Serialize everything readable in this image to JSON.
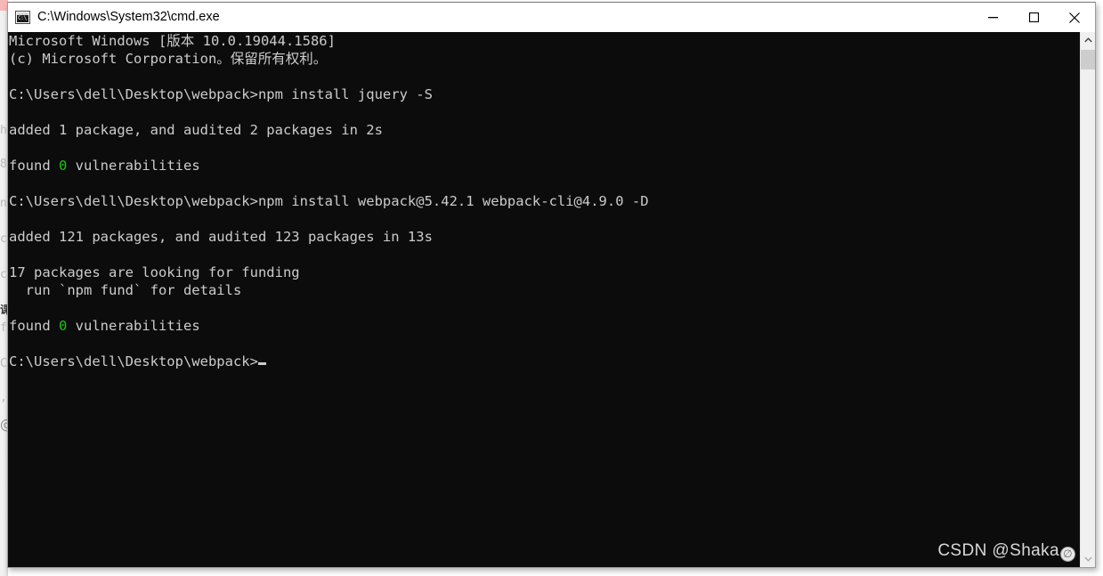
{
  "window": {
    "title": "C:\\Windows\\System32\\cmd.exe",
    "icon": "cmd-console-icon",
    "controls": {
      "minimize": "minimize-button",
      "maximize": "maximize-button",
      "close": "close-button"
    }
  },
  "console": {
    "background_color": "#0c0c0c",
    "foreground_color": "#cccccc",
    "highlight_color": "#16c60c",
    "lines": [
      {
        "text": "Microsoft Windows [版本 10.0.19044.1586]"
      },
      {
        "text": "(c) Microsoft Corporation。保留所有权利。"
      },
      {
        "text": ""
      },
      {
        "text": "C:\\Users\\dell\\Desktop\\webpack>npm install jquery -S"
      },
      {
        "text": ""
      },
      {
        "text": "added 1 package, and audited 2 packages in 2s"
      },
      {
        "text": ""
      },
      {
        "pre": "found ",
        "accent": "0",
        "post": " vulnerabilities"
      },
      {
        "text": ""
      },
      {
        "text": "C:\\Users\\dell\\Desktop\\webpack>npm install webpack@5.42.1 webpack-cli@4.9.0 -D"
      },
      {
        "text": ""
      },
      {
        "text": "added 121 packages, and audited 123 packages in 13s"
      },
      {
        "text": ""
      },
      {
        "text": "17 packages are looking for funding"
      },
      {
        "text": "  run `npm fund` for details"
      },
      {
        "text": ""
      },
      {
        "pre": "found ",
        "accent": "0",
        "post": " vulnerabilities"
      },
      {
        "text": ""
      },
      {
        "text": "C:\\Users\\dell\\Desktop\\webpack>",
        "cursor": true
      }
    ]
  },
  "scrollbar": {
    "up_arrow": "scroll-up-arrow",
    "down_arrow": "scroll-down-arrow",
    "thumb": "scroll-thumb"
  },
  "watermark": {
    "text": "CSDN @Shaka",
    "badge": "⌀"
  },
  "background_window": {
    "ghost_fragments": [
      "h",
      "8",
      "na",
      "c",
      "c|",
      "f",
      "C",
      ","
    ],
    "ghost_cn": "课"
  }
}
